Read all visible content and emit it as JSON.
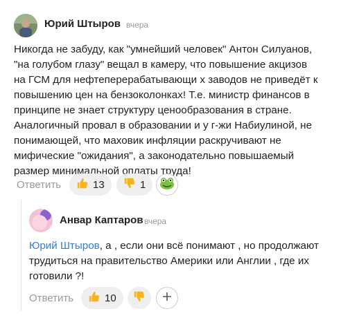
{
  "comment1": {
    "author": "Юрий Штыров",
    "time": "вчера",
    "text_lines": [
      "Никогда не забуду, как \"умнейший человек\" Антон Силуанов,",
      "\"на голубом глазу\" вещал в камеру, что повышение акцизов",
      "на ГСМ для нефтеперерабатывающи х заводов не приведёт к",
      "повышению цен на бензоколонках! Т.е. министр финансов в",
      "принципе не знает структуру ценообразования в стране.",
      "Аналогичный провал в образовании и у г-жи Набиулиной, не",
      "понимающей, что маховик инфляции раскручивают не",
      "мифические \"ожидания\", а законодательно повышаемый",
      "размер минимальной оплаты труда!"
    ],
    "reply_label": "Ответить",
    "likes": "13",
    "dislikes": "1",
    "icons": {
      "like": "thumbs-up-icon",
      "dislike": "thumbs-down-icon",
      "reaction": "frog-emoji-icon"
    }
  },
  "comment2": {
    "author": "Анвар Каптаров",
    "time": "вчера",
    "mention": "Юрий Штыров",
    "text_lines_after_mention": ", а , если они всё понимают , но продолжают",
    "text_lines": [
      "трудиться на правительство Америки или Англии , где их",
      "готовили ?!"
    ],
    "reply_label": "Ответить",
    "likes": "10",
    "icons": {
      "like": "thumbs-up-icon",
      "dislike": "thumbs-down-icon",
      "add": "plus-icon"
    }
  },
  "colors": {
    "mention": "#2f7fd8",
    "pill_bg": "#efefef",
    "muted": "#9a9a9a",
    "thumb": "#f5b31e"
  }
}
